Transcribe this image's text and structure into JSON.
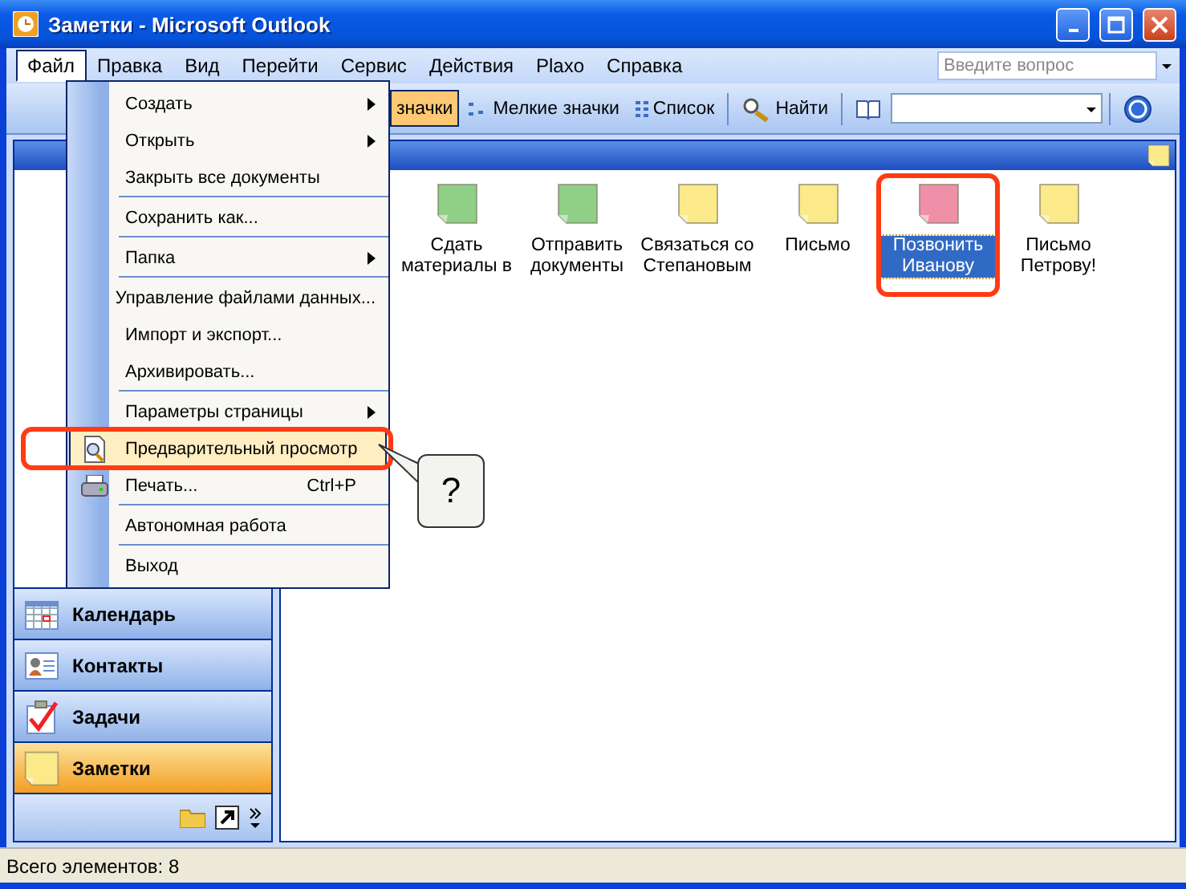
{
  "window": {
    "title": "Заметки - Microsoft Outlook"
  },
  "menu_bar": [
    {
      "label": "Файл",
      "selected": true
    },
    {
      "label": "Правка",
      "selected": false
    },
    {
      "label": "Вид",
      "selected": false
    },
    {
      "label": "Перейти",
      "selected": false
    },
    {
      "label": "Сервис",
      "selected": false
    },
    {
      "label": "Действия",
      "selected": false
    },
    {
      "label": "Plaxo",
      "selected": false
    },
    {
      "label": "Справка",
      "selected": false
    }
  ],
  "help_search": {
    "placeholder": "Введите вопрос"
  },
  "toolbar": [
    {
      "kind": "plain",
      "label": "значки",
      "pressed": true
    },
    {
      "kind": "small",
      "label": "Мелкие значки",
      "pressed": false
    },
    {
      "kind": "list",
      "label": "Список",
      "pressed": false
    },
    {
      "kind": "separator"
    },
    {
      "kind": "find",
      "label": "Найти",
      "pressed": false
    },
    {
      "kind": "separator"
    },
    {
      "kind": "book",
      "pressed": false
    },
    {
      "kind": "combo"
    },
    {
      "kind": "separator"
    },
    {
      "kind": "help",
      "pressed": false
    }
  ],
  "file_menu": [
    {
      "kind": "item",
      "label": "Создать",
      "submenu": true
    },
    {
      "kind": "item",
      "label": "Открыть",
      "submenu": true
    },
    {
      "kind": "item",
      "label": "Закрыть все документы"
    },
    {
      "kind": "separator"
    },
    {
      "kind": "item",
      "label": "Сохранить как..."
    },
    {
      "kind": "separator"
    },
    {
      "kind": "item",
      "label": "Папка",
      "submenu": true
    },
    {
      "kind": "separator"
    },
    {
      "kind": "item",
      "label": "Управление файлами данных..."
    },
    {
      "kind": "item",
      "label": "Импорт и экспорт..."
    },
    {
      "kind": "item",
      "label": "Архивировать..."
    },
    {
      "kind": "separator"
    },
    {
      "kind": "item",
      "label": "Параметры страницы",
      "submenu": true
    },
    {
      "kind": "preview",
      "label": "Предварительный просмотр",
      "selected": true,
      "highlighted": true
    },
    {
      "kind": "print",
      "label": "Печать...",
      "shortcut": "Ctrl+P"
    },
    {
      "kind": "separator"
    },
    {
      "kind": "item",
      "label": "Автономная работа"
    },
    {
      "kind": "separator"
    },
    {
      "kind": "item",
      "label": "Выход"
    }
  ],
  "callout": {
    "text": "?"
  },
  "nav_buttons": [
    {
      "kind": "calendar",
      "label": "Календарь",
      "selected": false
    },
    {
      "kind": "contacts",
      "label": "Контакты",
      "selected": false
    },
    {
      "kind": "tasks",
      "label": "Задачи",
      "selected": false
    },
    {
      "kind": "notes",
      "label": "Заметки",
      "selected": true
    }
  ],
  "notes": [
    {
      "title": "Сдать материалы в",
      "color": "#8fcf86",
      "selected": false,
      "highlighted": false
    },
    {
      "title": "Отправить документы",
      "color": "#8fcf86",
      "selected": false,
      "highlighted": false
    },
    {
      "title": "Связаться со Степановым",
      "color": "#fbe98a",
      "selected": false,
      "highlighted": false
    },
    {
      "title": "Письмо",
      "color": "#fbe98a",
      "selected": false,
      "highlighted": false
    },
    {
      "title": "Позвонить Иванову",
      "color": "#f08fa8",
      "selected": true,
      "highlighted": true
    },
    {
      "title": "Письмо Петрову!",
      "color": "#fbe98a",
      "selected": false,
      "highlighted": false
    }
  ],
  "status_bar": {
    "text": "Всего элементов: 8"
  }
}
